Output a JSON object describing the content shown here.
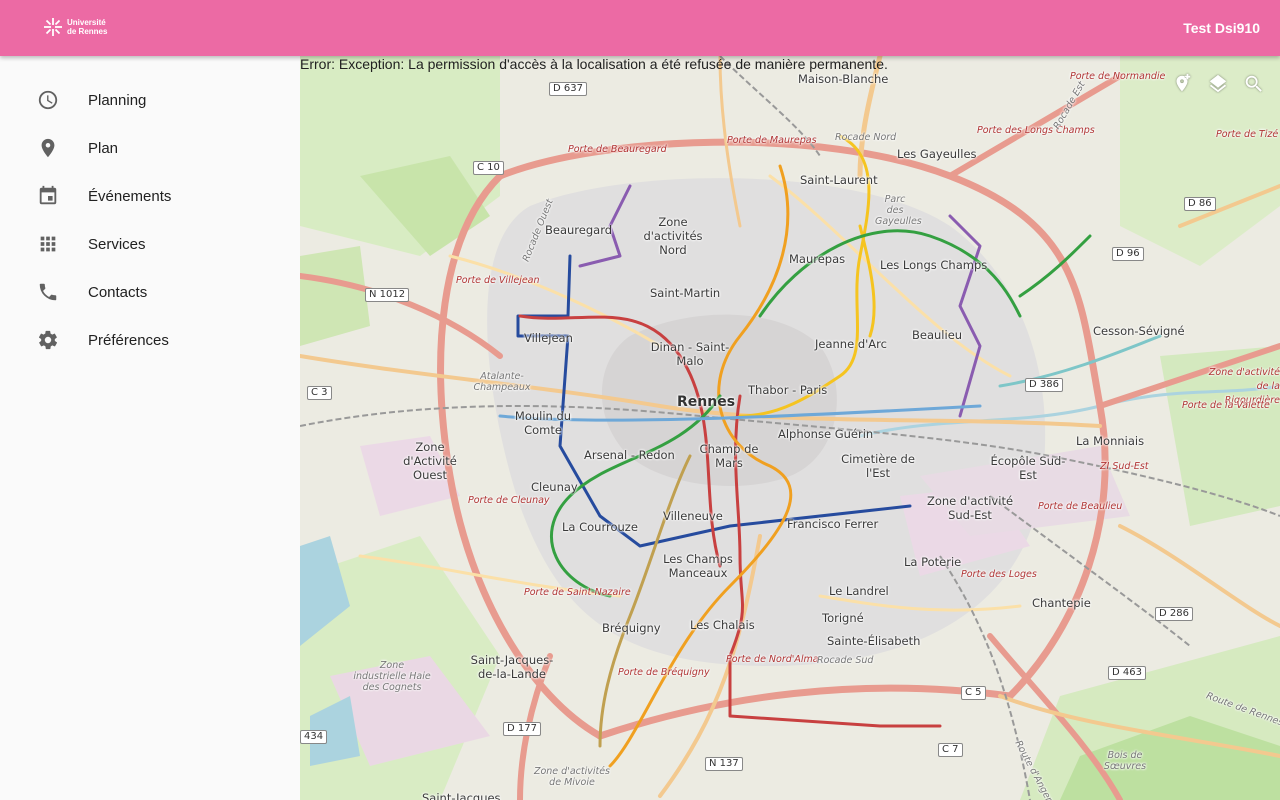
{
  "app": {
    "logo_line1": "Université",
    "logo_line2": "de Rennes",
    "user_name": "Test Dsi910",
    "accent_color": "#ec6aa4"
  },
  "drawer": {
    "items": [
      {
        "label": "Planning",
        "icon": "clock-icon"
      },
      {
        "label": "Plan",
        "icon": "location-pin-icon"
      },
      {
        "label": "Événements",
        "icon": "calendar-icon"
      },
      {
        "label": "Services",
        "icon": "grid-icon"
      },
      {
        "label": "Contacts",
        "icon": "phone-icon"
      },
      {
        "label": "Préférences",
        "icon": "gear-icon"
      }
    ]
  },
  "map": {
    "error_message": "Error: Exception: La permission d'accès à la localisation a été refusée de manière permanente.",
    "tools": [
      "add-location-icon",
      "layers-icon",
      "search-icon"
    ],
    "places": {
      "rennes": "Rennes",
      "maison_blanche": "Maison-Blanche",
      "les_gayeulles": "Les Gayeulles",
      "saint_laurent": "Saint-Laurent",
      "parc_gayeulles": "Parc des Gayeulles",
      "beauregard": "Beauregard",
      "zone_nord": "Zone d'activités Nord",
      "maurepas": "Maurepas",
      "les_longs_champs": "Les Longs Champs",
      "saint_martin": "Saint-Martin",
      "beaulieu": "Beaulieu",
      "cesson": "Cesson-Sévigné",
      "villejean": "Villejean",
      "dinan_saint_malo": "Dinan - Saint-Malo",
      "jeanne_darc": "Jeanne d'Arc",
      "thabor": "Thabor - Paris",
      "moulin_du_comte": "Moulin du Comte",
      "alphonse_guerin": "Alphonse Guérin",
      "la_monniais": "La Monniais",
      "zone_ouest": "Zone d'Activité Ouest",
      "arsenal": "Arsenal - Redon",
      "champ_de_mars": "Champ de Mars",
      "cimetiere": "Cimetière de l'Est",
      "ecopole": "Écopôle Sud-Est",
      "cleunay": "Cleunay",
      "villeneuve": "Villeneuve",
      "la_courrouze": "La Courrouze",
      "francisco_ferrer": "Francisco Ferrer",
      "zone_sud_est": "Zone d'activité Sud-Est",
      "les_champs_manceaux": "Les Champs Manceaux",
      "la_poterie": "La Poterie",
      "le_landrel": "Le Landrel",
      "torigne": "Torigné",
      "chantepie": "Chantepie",
      "brequigny": "Bréquigny",
      "les_chalais": "Les Chalais",
      "sainte_elisabeth": "Sainte-Élisabeth",
      "saint_jacques": "Saint-Jacques-de-la-Lande",
      "zone_ind_haie": "Zone industrielle Haie des Cognets",
      "zone_mivoie": "Zone d'activités de Mivoie",
      "atalante": "Atalante-Champeaux",
      "saint_jacques_bottom": "Saint-Jacques",
      "bois_soeuvres": "Bois de Sœuvres",
      "zi_sud_est": "ZI Sud-Est"
    },
    "portes": {
      "normandie": "Porte de Normandie",
      "maurepas": "Porte de Maurepas",
      "beauregard": "Porte de Beauregard",
      "longs_champs": "Porte des Longs Champs",
      "tize": "Porte de Tizé",
      "villejean": "Porte de Villejean",
      "rigourdiere": "Zone d'activité de la Rigourdière",
      "valette": "Porte de la Valette",
      "cleunay": "Porte de Cleunay",
      "beaulieu": "Porte de Beaulieu",
      "loges": "Porte des Loges",
      "saint_nazaire": "Porte de Saint-Nazaire",
      "alma": "Porte de Nord'Alma",
      "brequigny": "Porte de Bréquigny"
    },
    "roads": {
      "d637": "D 637",
      "c10": "C 10",
      "d86": "D 86",
      "d96": "D 96",
      "n1012": "N 1012",
      "c3": "C 3",
      "d386": "D 386",
      "d286": "D 286",
      "d463": "D 463",
      "c5": "C 5",
      "c7": "C 7",
      "n137": "N 137",
      "d177": "D 177",
      "r434": "434",
      "rocade_nord": "Rocade Nord",
      "rocade_sud": "Rocade Sud",
      "rocade_ouest": "Rocade Ouest",
      "rocade_est": "Rocade Est",
      "route_rennes": "Route de Rennes",
      "route_angers": "Route d'Angers"
    }
  }
}
